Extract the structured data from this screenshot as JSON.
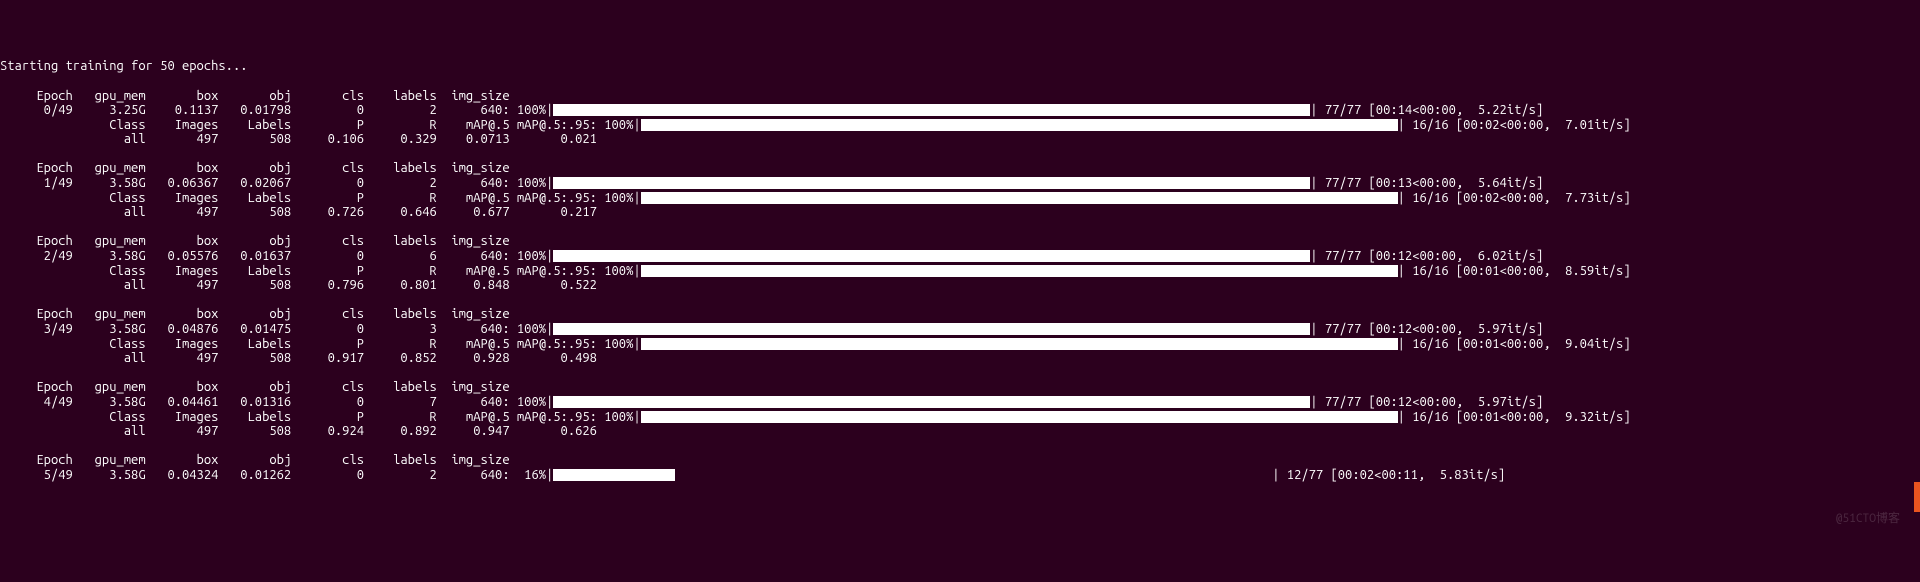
{
  "header": "Starting training for 50 epochs...",
  "col_headers_train": {
    "epoch": "Epoch",
    "gpu_mem": "gpu_mem",
    "box": "box",
    "obj": "obj",
    "cls": "cls",
    "labels": "labels",
    "img_size": "img_size"
  },
  "col_headers_val": {
    "class": "Class",
    "images": "Images",
    "labels": "Labels",
    "p": "P",
    "r": "R",
    "map50": "mAP@.5",
    "map5095": "mAP@.5:.95:"
  },
  "epochs": [
    {
      "epoch": "0/49",
      "gpu_mem": "3.25G",
      "box": "0.1137",
      "obj": "0.01798",
      "cls": "0",
      "labels": "2",
      "img_size": "640:",
      "train_pct": "100%",
      "train_stats": " 77/77 [00:14<00:00,  5.22it/s]",
      "val_all": "all",
      "images": "497",
      "vlabels": "508",
      "p": "0.106",
      "r": "0.329",
      "map50": "0.0713",
      "map5095": "0.021",
      "val_pct": "100%",
      "val_stats": " 16/16 [00:02<00:00,  7.01it/s]"
    },
    {
      "epoch": "1/49",
      "gpu_mem": "3.58G",
      "box": "0.06367",
      "obj": "0.02067",
      "cls": "0",
      "labels": "2",
      "img_size": "640:",
      "train_pct": "100%",
      "train_stats": " 77/77 [00:13<00:00,  5.64it/s]",
      "val_all": "all",
      "images": "497",
      "vlabels": "508",
      "p": "0.726",
      "r": "0.646",
      "map50": "0.677",
      "map5095": "0.217",
      "val_pct": "100%",
      "val_stats": " 16/16 [00:02<00:00,  7.73it/s]"
    },
    {
      "epoch": "2/49",
      "gpu_mem": "3.58G",
      "box": "0.05576",
      "obj": "0.01637",
      "cls": "0",
      "labels": "6",
      "img_size": "640:",
      "train_pct": "100%",
      "train_stats": " 77/77 [00:12<00:00,  6.02it/s]",
      "val_all": "all",
      "images": "497",
      "vlabels": "508",
      "p": "0.796",
      "r": "0.801",
      "map50": "0.848",
      "map5095": "0.522",
      "val_pct": "100%",
      "val_stats": " 16/16 [00:01<00:00,  8.59it/s]"
    },
    {
      "epoch": "3/49",
      "gpu_mem": "3.58G",
      "box": "0.04876",
      "obj": "0.01475",
      "cls": "0",
      "labels": "3",
      "img_size": "640:",
      "train_pct": "100%",
      "train_stats": " 77/77 [00:12<00:00,  5.97it/s]",
      "val_all": "all",
      "images": "497",
      "vlabels": "508",
      "p": "0.917",
      "r": "0.852",
      "map50": "0.928",
      "map5095": "0.498",
      "val_pct": "100%",
      "val_stats": " 16/16 [00:01<00:00,  9.04it/s]"
    },
    {
      "epoch": "4/49",
      "gpu_mem": "3.58G",
      "box": "0.04461",
      "obj": "0.01316",
      "cls": "0",
      "labels": "7",
      "img_size": "640:",
      "train_pct": "100%",
      "train_stats": " 77/77 [00:12<00:00,  5.97it/s]",
      "val_all": "all",
      "images": "497",
      "vlabels": "508",
      "p": "0.924",
      "r": "0.892",
      "map50": "0.947",
      "map5095": "0.626",
      "val_pct": "100%",
      "val_stats": " 16/16 [00:01<00:00,  9.32it/s]"
    }
  ],
  "last": {
    "epoch": "5/49",
    "gpu_mem": "3.58G",
    "box": "0.04324",
    "obj": "0.01262",
    "cls": "0",
    "labels": "2",
    "img_size": "640:",
    "train_pct": " 16%",
    "train_stats": " 12/77 [00:02<00:11,  5.83it/s]"
  },
  "watermark": "@51CTO博客"
}
